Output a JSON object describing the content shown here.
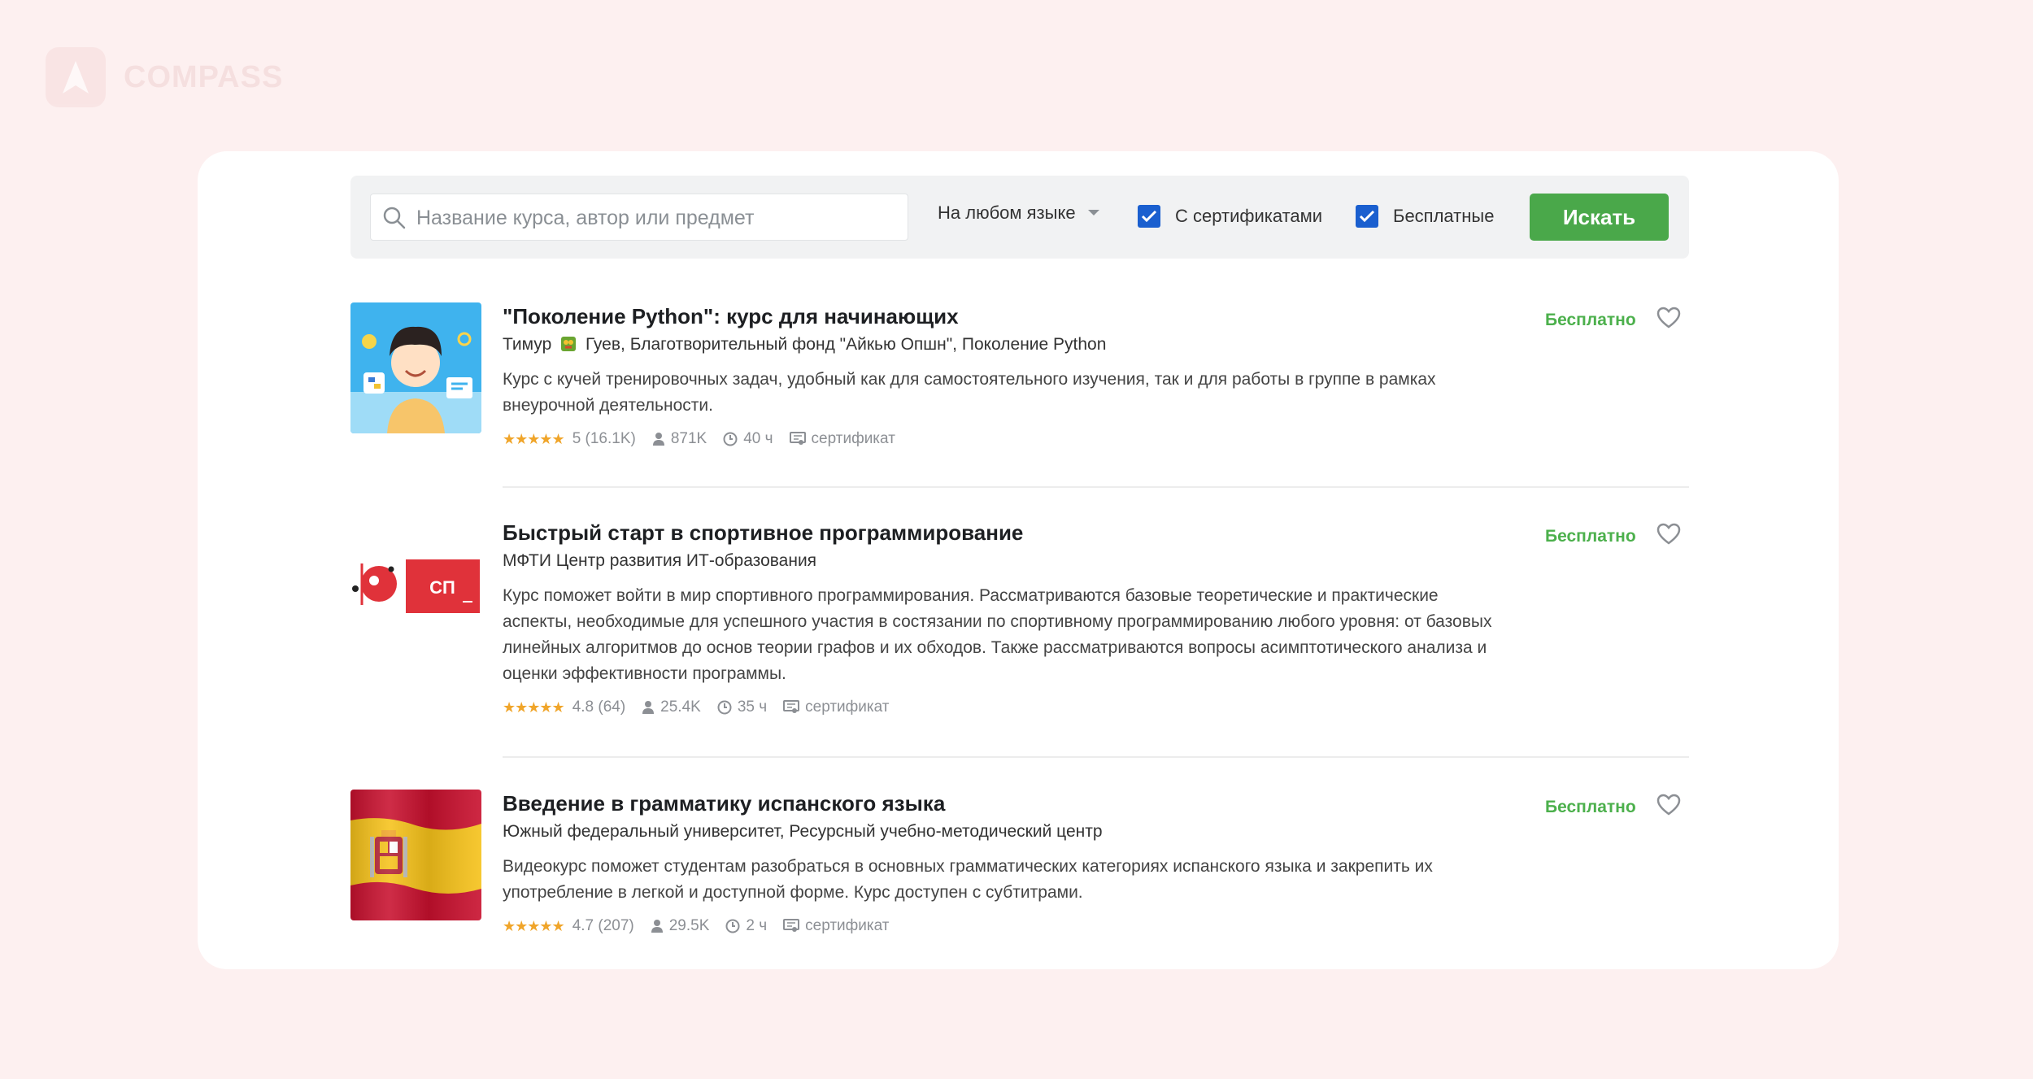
{
  "brand": {
    "name": "COMPASS"
  },
  "search": {
    "placeholder": "Название курса, автор или предмет",
    "language_label": "На любом языке",
    "certificates_label": "С сертификатами",
    "free_label": "Бесплатные",
    "button_label": "Искать"
  },
  "colors": {
    "accent_green": "#4aa84a",
    "price_green": "#4cb04c",
    "checkbox_blue": "#1a5fcf",
    "star_orange": "#f0a52a"
  },
  "courses": [
    {
      "title": "\"Поколение Python\": курс для начинающих",
      "authors_before_icon": "Тимур",
      "authors_after_icon": "Гуев, Благотворительный фонд \"Айкью Опшн\", Поколение Python",
      "description": "Курс с кучей тренировочных задач, удобный как для самостоятельного изучения, так и для работы в группе в рамках внеурочной деятельности.",
      "stars": "★★★★★",
      "rating": "5 (16.1K)",
      "learners": "871K",
      "duration": "40 ч",
      "certificate": "сертификат",
      "price": "Бесплатно"
    },
    {
      "title": "Быстрый старт в спортивное программирование",
      "authors": "МФТИ Центр развития ИТ-образования",
      "description": "Курс поможет войти в мир спортивного программирования. Рассматриваются базовые теоретические и практические аспекты, необходимые для успешного участия в состязании по спортивному программированию любого уровня: от базовых линейных алгоритмов до основ теории графов и их обходов. Также рассматриваются вопросы асимптотического анализа и оценки эффективности программы.",
      "thumb_text": "СП",
      "stars": "★★★★★",
      "rating": "4.8 (64)",
      "learners": "25.4K",
      "duration": "35 ч",
      "certificate": "сертификат",
      "price": "Бесплатно"
    },
    {
      "title": "Введение в грамматику испанского языка",
      "authors": "Южный федеральный университет, Ресурсный учебно-методический центр",
      "description": "Видеокурс поможет студентам разобраться в основных грамматических категориях испанского языка и закрепить их употребление в легкой и доступной форме. Курс доступен с субтитрами.",
      "stars": "★★★★★",
      "rating": "4.7 (207)",
      "learners": "29.5K",
      "duration": "2 ч",
      "certificate": "сертификат",
      "price": "Бесплатно"
    }
  ]
}
